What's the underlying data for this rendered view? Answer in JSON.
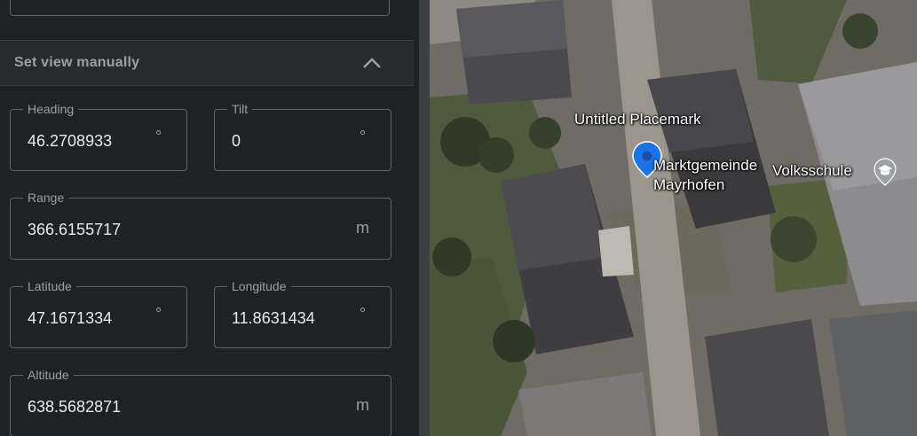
{
  "panel": {
    "section_title": "Set view manually",
    "fields": {
      "heading": {
        "label": "Heading",
        "value": "46.2708933",
        "unit": "°"
      },
      "tilt": {
        "label": "Tilt",
        "value": "0",
        "unit": "°"
      },
      "range": {
        "label": "Range",
        "value": "366.6155717",
        "unit": "m"
      },
      "latitude": {
        "label": "Latitude",
        "value": "47.1671334",
        "unit": "°"
      },
      "longitude": {
        "label": "Longitude",
        "value": "11.8631434",
        "unit": "°"
      },
      "altitude": {
        "label": "Altitude",
        "value": "638.5682871",
        "unit": "m"
      }
    }
  },
  "map": {
    "placemark_label": "Untitled Placemark",
    "place_label_line1": "Marktgemeinde",
    "place_label_line2": "Mayrhofen",
    "school_label": "Volksschule",
    "pin_color": "#1a73e8"
  },
  "colors": {
    "panel_bg": "#202124",
    "header_bg": "#292a2d",
    "border": "#5f6368",
    "text_primary": "#e8eaed",
    "text_secondary": "#9aa0a6"
  }
}
